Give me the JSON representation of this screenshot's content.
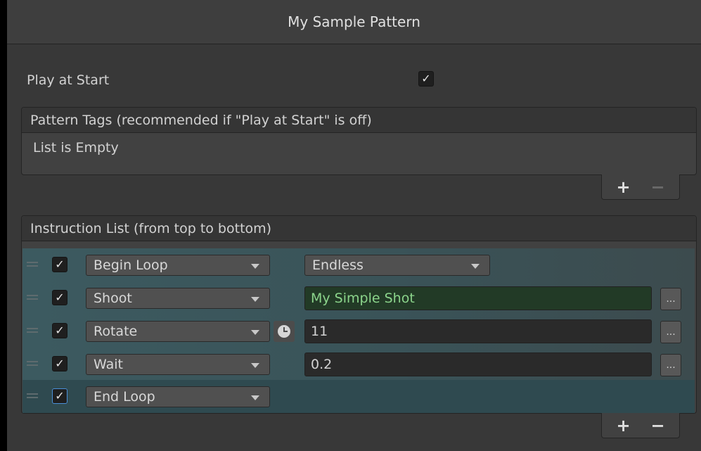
{
  "window": {
    "title": "My Sample Pattern"
  },
  "play_at_start": {
    "label": "Play at Start",
    "checked": true,
    "check_glyph": "✓"
  },
  "pattern_tags": {
    "header": "Pattern Tags (recommended if \"Play at Start\" is off)",
    "empty_text": "List is Empty",
    "add_label": "+",
    "remove_label": "−"
  },
  "instruction_list": {
    "header": "Instruction List (from top to bottom)",
    "add_label": "+",
    "remove_label": "−",
    "rows": [
      {
        "enabled_glyph": "✓",
        "type": "Begin Loop",
        "value": "Endless"
      },
      {
        "enabled_glyph": "✓",
        "type": "Shoot",
        "value": "My Simple Shot",
        "more": "..."
      },
      {
        "enabled_glyph": "✓",
        "type": "Rotate",
        "value": "11",
        "more": "..."
      },
      {
        "enabled_glyph": "✓",
        "type": "Wait",
        "value": "0.2",
        "more": "..."
      },
      {
        "enabled_glyph": "✓",
        "type": "End Loop"
      }
    ]
  },
  "colors": {
    "panel_bg": "#383838",
    "row_highlight": "#3a5358",
    "shot_field_bg": "#223a26",
    "shot_field_text": "#8bd48b"
  },
  "icons": [
    "check-icon",
    "drag-handle-icon",
    "dropdown-arrow-icon",
    "clock-icon",
    "more-options-icon",
    "plus-icon",
    "minus-icon"
  ]
}
